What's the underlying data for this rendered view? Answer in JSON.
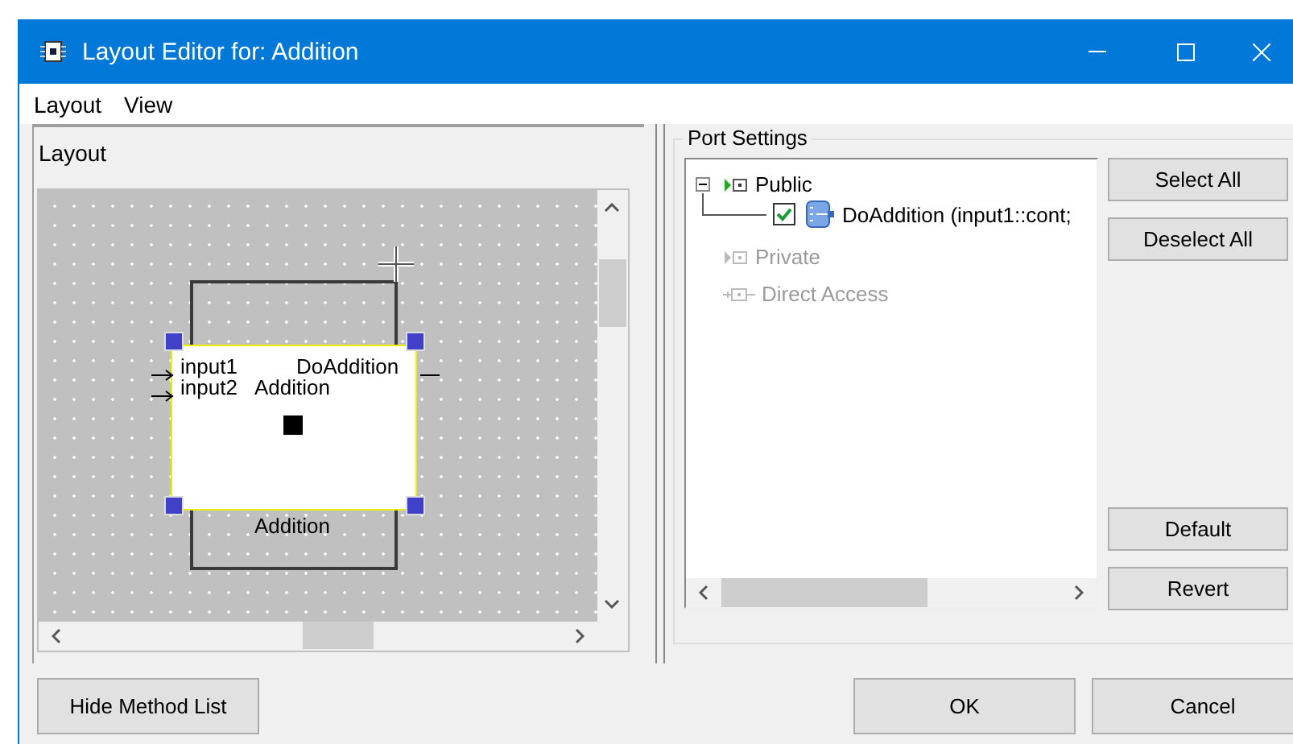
{
  "window": {
    "title": "Layout Editor for: Addition"
  },
  "menu": [
    {
      "label": "Layout"
    },
    {
      "label": "View"
    }
  ],
  "layout_panel": {
    "title": "Layout",
    "block": {
      "method": "DoAddition",
      "name": "Addition",
      "caption": "Addition",
      "inputs": [
        "input1",
        "input2"
      ],
      "selected": true
    }
  },
  "port_settings": {
    "title": "Port Settings",
    "tree": [
      {
        "label": "Public",
        "kind": "port",
        "disabled": false,
        "expanded": true,
        "children": [
          {
            "label": "DoAddition (input1::cont;",
            "checked": true
          }
        ]
      },
      {
        "label": "Private",
        "kind": "port",
        "disabled": true
      },
      {
        "label": "Direct Access",
        "kind": "access",
        "disabled": true
      }
    ],
    "top_buttons": [
      "Select All",
      "Deselect All"
    ],
    "bottom_buttons": [
      "Default",
      "Revert"
    ]
  },
  "footer": {
    "left_button": "Hide Method List",
    "buttons": [
      "OK",
      "Cancel"
    ]
  }
}
